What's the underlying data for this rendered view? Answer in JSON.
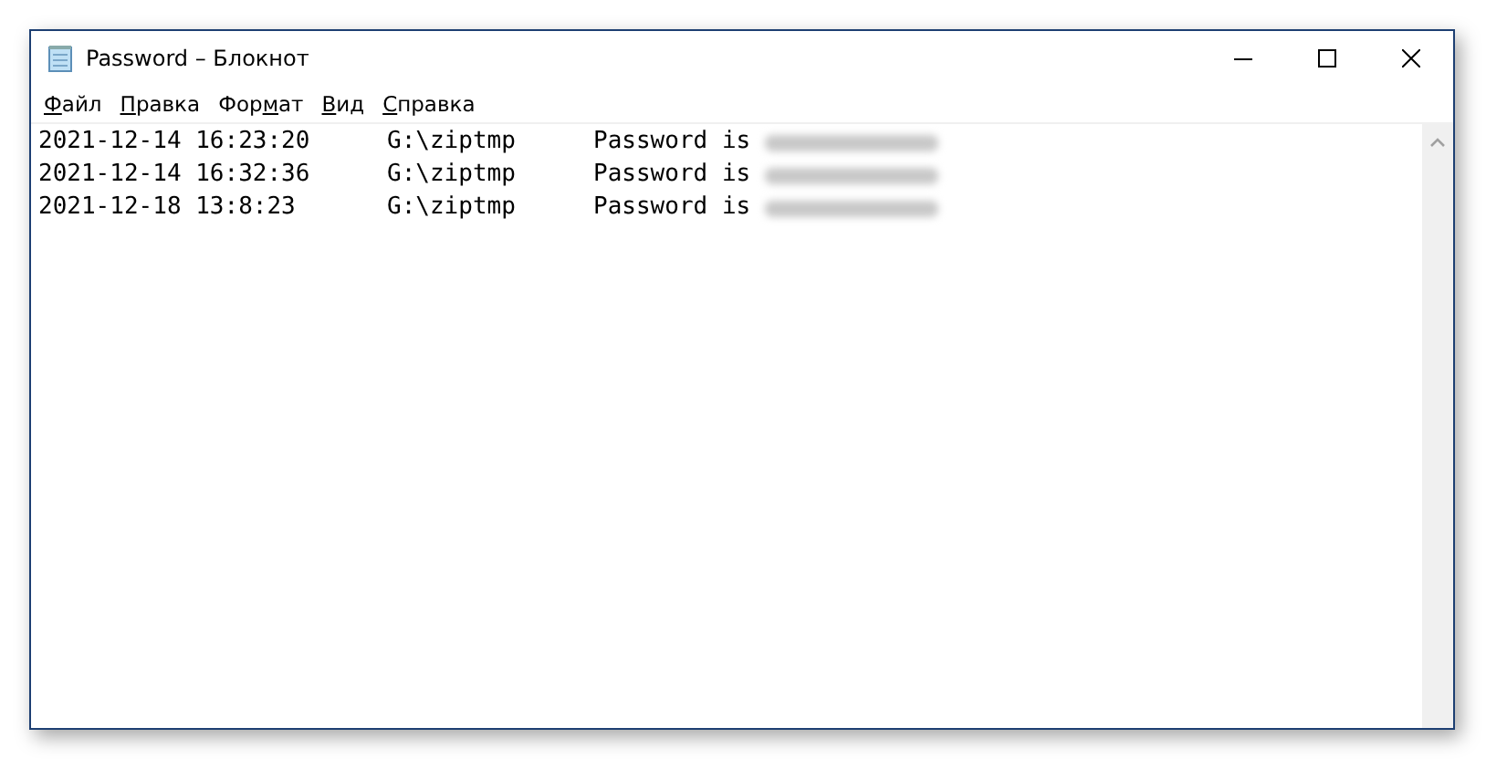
{
  "window": {
    "title": "Password – Блокнот"
  },
  "menu": [
    {
      "key": "Ф",
      "after": "айл"
    },
    {
      "key": "П",
      "after": "равка"
    },
    {
      "before": "Фор",
      "key": "м",
      "after": "ат"
    },
    {
      "key": "В",
      "after": "ид"
    },
    {
      "key": "С",
      "after": "правка"
    }
  ],
  "lines": [
    {
      "date": "2021-12-14 16:23:20",
      "path": "G:\\ziptmp",
      "text": "Password is"
    },
    {
      "date": "2021-12-14 16:32:36",
      "path": "G:\\ziptmp",
      "text": "Password is"
    },
    {
      "date": "2021-12-18 13:8:23",
      "path": "G:\\ziptmp",
      "text": "Password is"
    }
  ]
}
